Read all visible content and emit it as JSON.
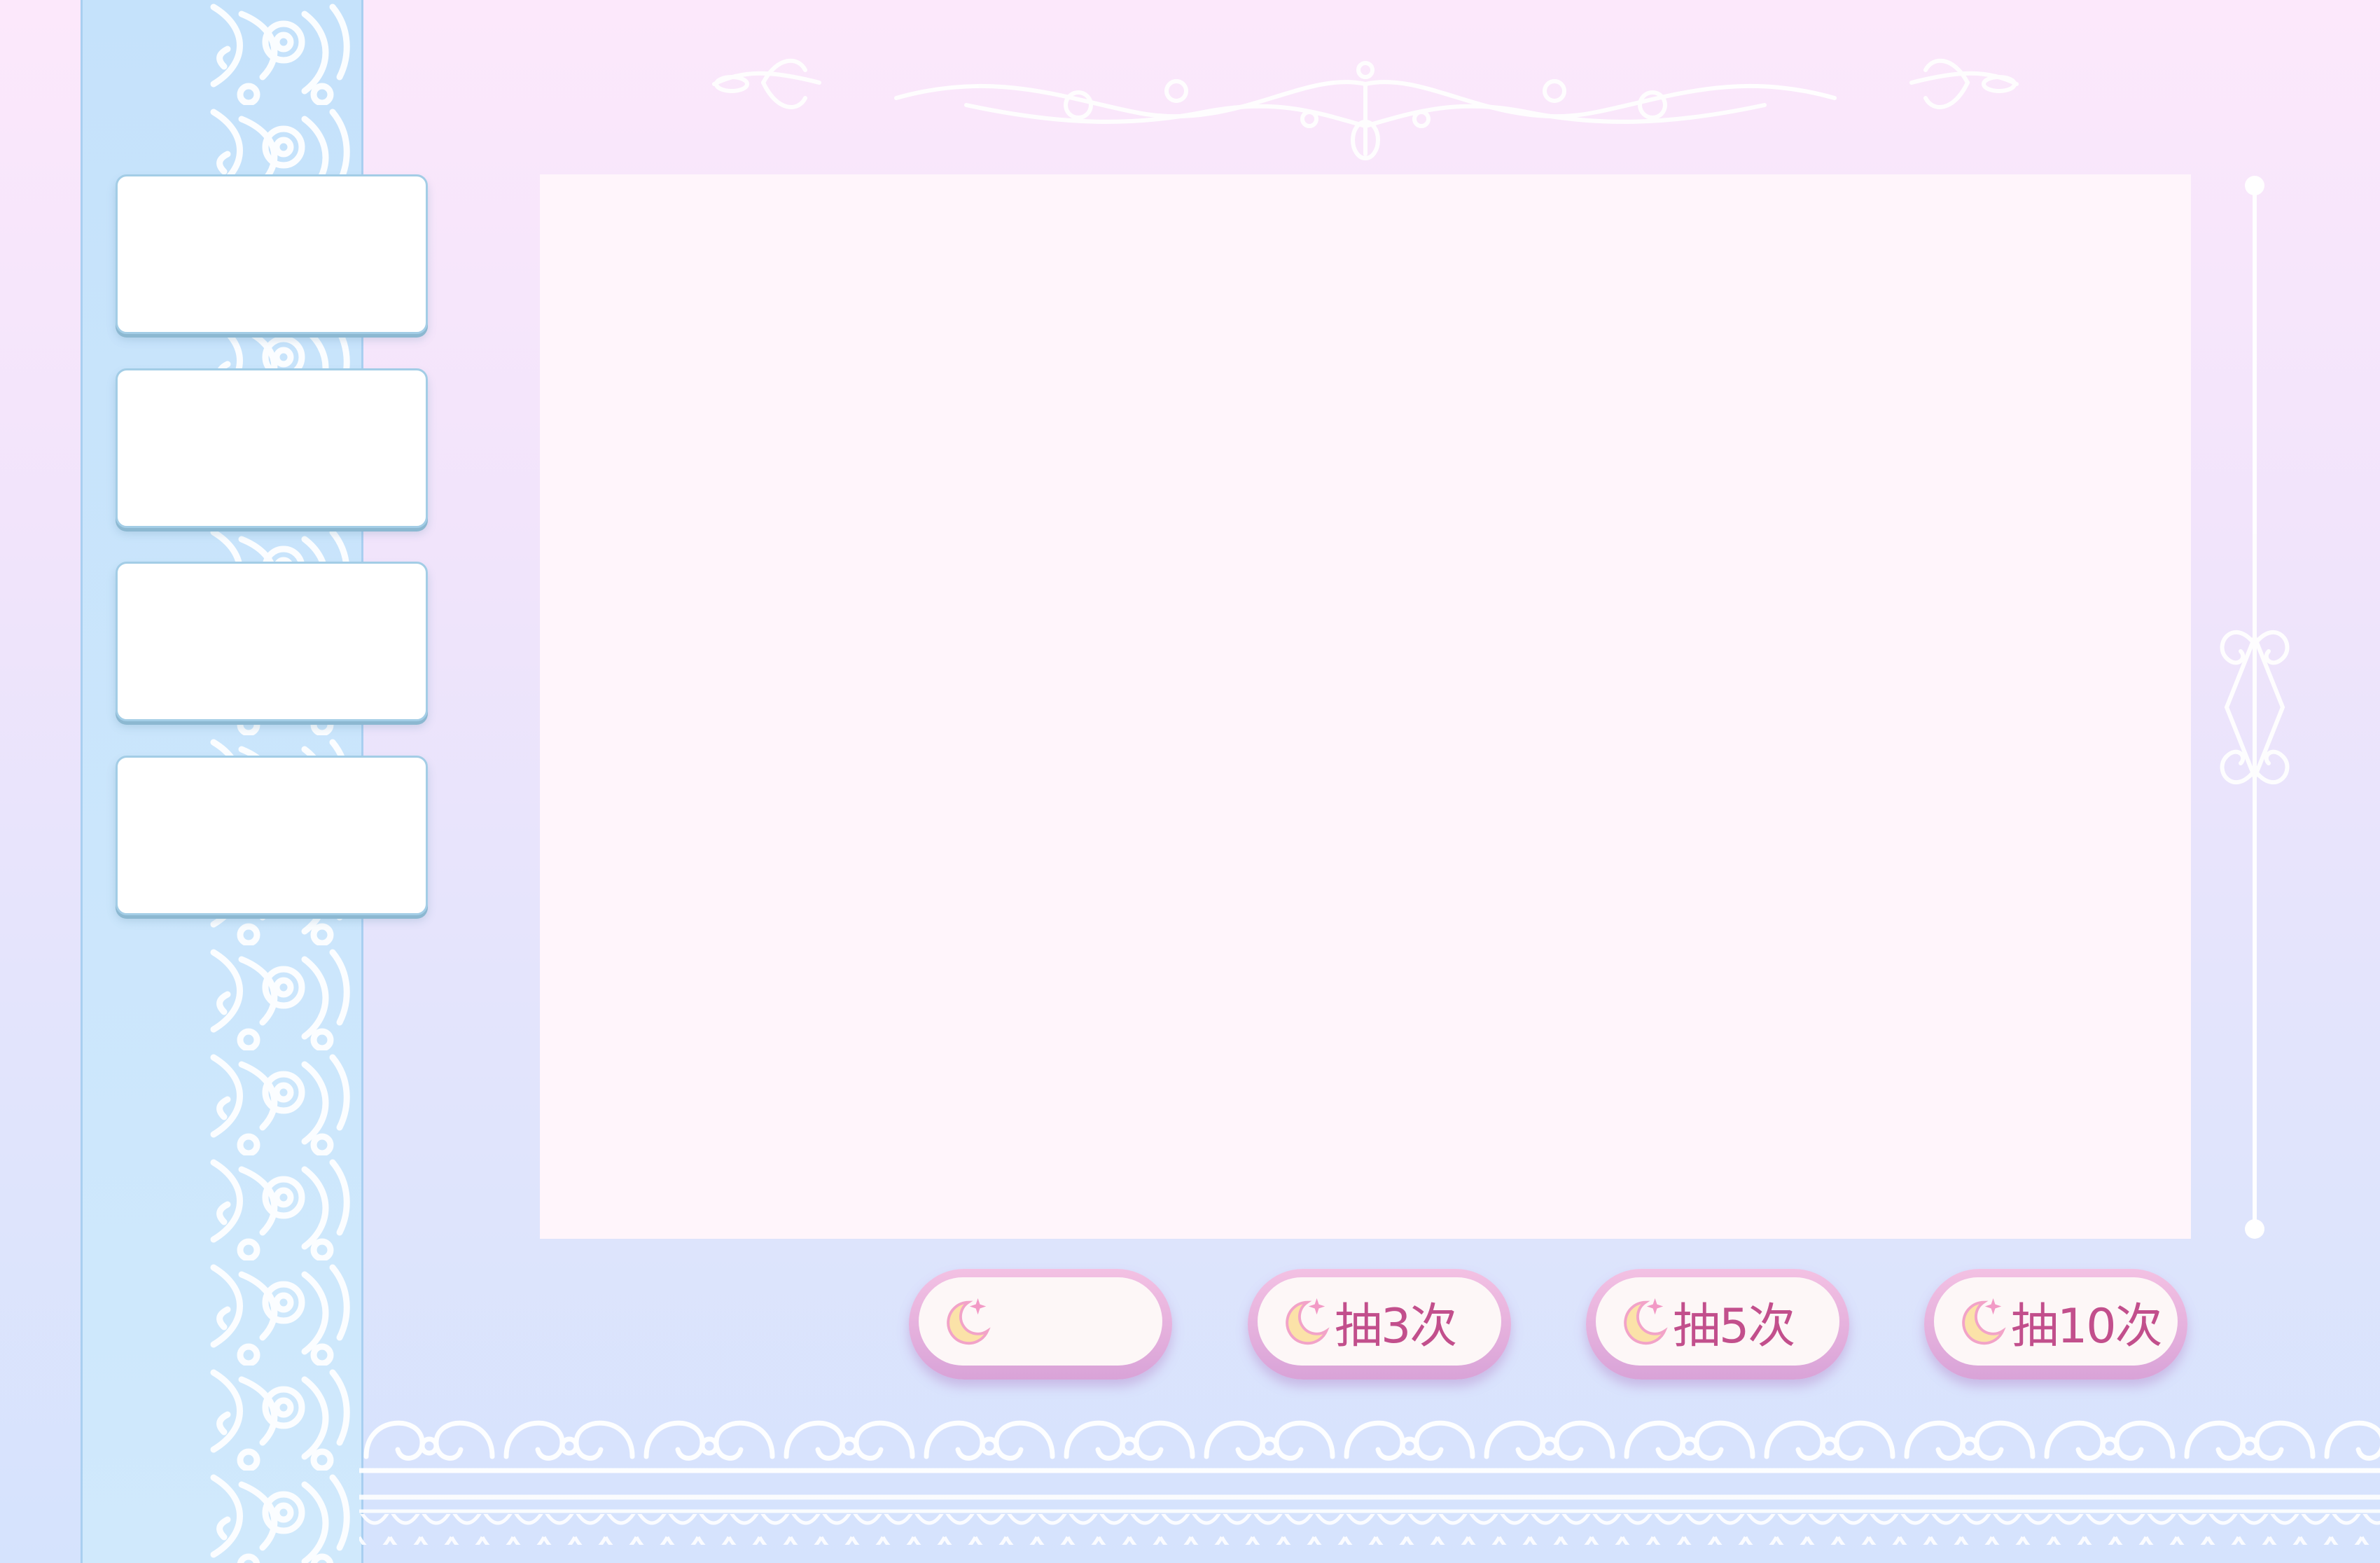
{
  "sidebar": {
    "cards": [
      {
        "label": ""
      },
      {
        "label": ""
      },
      {
        "label": ""
      },
      {
        "label": ""
      }
    ]
  },
  "main_panel": {
    "content": ""
  },
  "draw_buttons": [
    {
      "label": "",
      "icon": "moon-star-icon"
    },
    {
      "label": "抽3次",
      "icon": "moon-star-icon"
    },
    {
      "label": "抽5次",
      "icon": "moon-star-icon"
    },
    {
      "label": "抽10次",
      "icon": "moon-star-icon"
    }
  ],
  "colors": {
    "background_top": "#fce8fb",
    "background_bottom": "#d5e3fd",
    "sidebar_strip": "#c5e2fb",
    "button_border": "#e2acd9",
    "button_text": "#c24f8c",
    "panel": "#fff5fb"
  }
}
